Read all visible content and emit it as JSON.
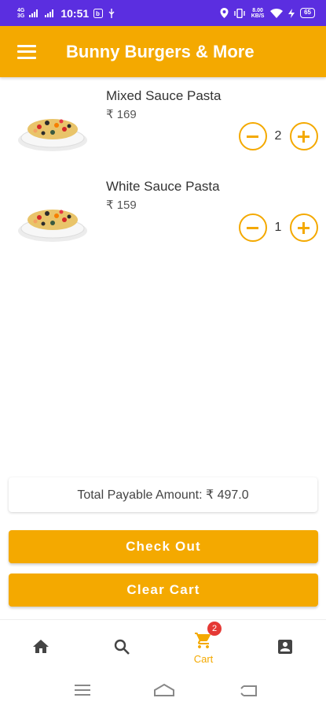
{
  "status_bar": {
    "network_top": "4G",
    "network_bottom": "3G",
    "time": "10:51",
    "speed": "8.00 KB/S",
    "battery": "65"
  },
  "app_bar": {
    "title": "Bunny Burgers & More",
    "menu_icon": "hamburger-menu-icon"
  },
  "cart": {
    "items": [
      {
        "name": "Mixed Sauce Pasta",
        "price": "₹ 169",
        "quantity": "2",
        "image_icon": "pasta-bowl-image"
      },
      {
        "name": "White Sauce Pasta",
        "price": "₹ 159",
        "quantity": "1",
        "image_icon": "pasta-bowl-image"
      }
    ]
  },
  "total": {
    "label": "Total Payable Amount: ₹ 497.0"
  },
  "actions": {
    "checkout": "Check Out",
    "clear": "Clear Cart"
  },
  "bottom_nav": {
    "items": [
      {
        "icon": "home-icon"
      },
      {
        "icon": "search-icon"
      },
      {
        "icon": "cart-icon",
        "label": "Cart",
        "badge": "2",
        "active": true
      },
      {
        "icon": "account-box-icon"
      }
    ]
  },
  "colors": {
    "primary": "#f4a900",
    "status_bar": "#5b2ee0",
    "badge": "#e53935"
  }
}
